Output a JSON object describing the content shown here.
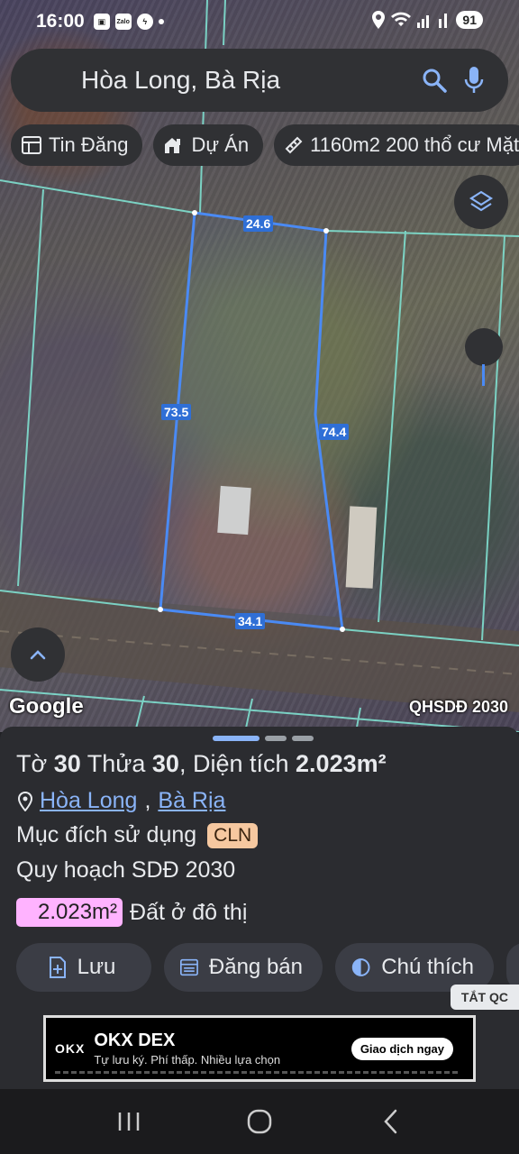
{
  "status_bar": {
    "time": "16:00",
    "left_icons": [
      "screenshot-icon",
      "zalo-icon",
      "messenger-icon",
      "dot-icon"
    ],
    "zalo_label": "Zalo",
    "battery": "91"
  },
  "search": {
    "query": "Hòa Long, Bà Rịa"
  },
  "chips": [
    {
      "label": "Tin Đăng",
      "icon": "listing-icon"
    },
    {
      "label": "Dự Án",
      "icon": "project-icon"
    },
    {
      "label": "1160m2 200 thổ cư Mặt",
      "icon": "ruler-icon"
    }
  ],
  "map": {
    "edge_labels": {
      "top": "24.6",
      "left": "73.5",
      "right": "74.4",
      "bottom": "34.1"
    },
    "google_logo": "Google",
    "overlay_tag": "QHSDĐ 2030"
  },
  "parcel": {
    "sheet_prefix": "Tờ",
    "sheet_no": "30",
    "plot_prefix": "Thửa",
    "plot_no": "30",
    "area_prefix": ", Diện tích",
    "area": "2.023m²",
    "ward": "Hòa Long",
    "city": "Bà Rịa",
    "purpose_label": "Mục đích sử dụng",
    "purpose_code": "CLN",
    "plan_label": "Quy hoạch SDĐ 2030",
    "plan_area": "2.023m²",
    "plan_use": "Đất ở đô thị"
  },
  "actions": [
    {
      "label": "Lưu",
      "icon": "save-icon"
    },
    {
      "label": "Đăng bán",
      "icon": "post-icon"
    },
    {
      "label": "Chú thích",
      "icon": "legend-icon"
    }
  ],
  "ad": {
    "close_label": "TẮT QC",
    "brand": "OKX",
    "title": "OKX DEX",
    "subtitle": "Tự lưu ký. Phí thấp. Nhiều lựa chọn",
    "cta": "Giao dịch ngay"
  },
  "colors": {
    "accent": "#8ab4f8",
    "parcel_outline": "#4a8af4",
    "cln_badge": "#f6c8a0",
    "plan_badge": "#ffb3ff"
  }
}
